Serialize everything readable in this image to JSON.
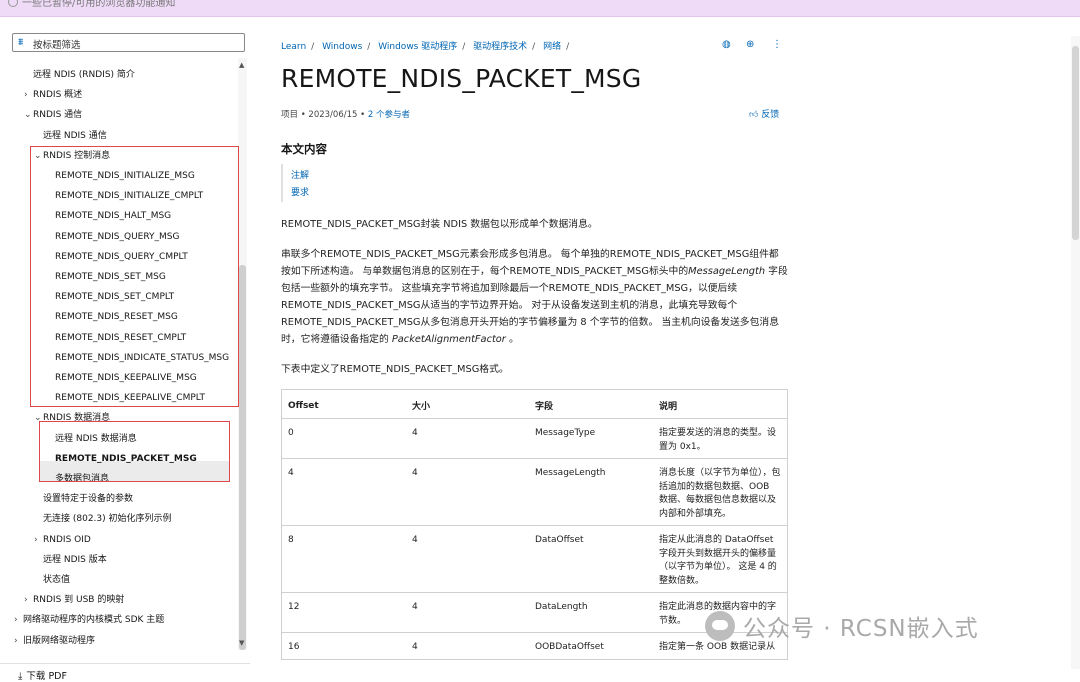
{
  "topbar": {
    "message": "一些已暂停/可用的浏览器功能通知"
  },
  "sidebar": {
    "filter_placeholder": "按标题筛选",
    "download_pdf": "下载 PDF",
    "items": [
      {
        "label": "远程 NDIS (RNDIS) 简介",
        "chev": ""
      },
      {
        "label": "RNDIS 概述",
        "chev": "›"
      },
      {
        "label": "RNDIS 通信",
        "chev": "⌄"
      },
      {
        "label": "远程 NDIS 通信",
        "chev": ""
      },
      {
        "label": "RNDIS 控制消息",
        "chev": "⌄"
      },
      {
        "label": "REMOTE_NDIS_INITIALIZE_MSG",
        "chev": ""
      },
      {
        "label": "REMOTE_NDIS_INITIALIZE_CMPLT",
        "chev": ""
      },
      {
        "label": "REMOTE_NDIS_HALT_MSG",
        "chev": ""
      },
      {
        "label": "REMOTE_NDIS_QUERY_MSG",
        "chev": ""
      },
      {
        "label": "REMOTE_NDIS_QUERY_CMPLT",
        "chev": ""
      },
      {
        "label": "REMOTE_NDIS_SET_MSG",
        "chev": ""
      },
      {
        "label": "REMOTE_NDIS_SET_CMPLT",
        "chev": ""
      },
      {
        "label": "REMOTE_NDIS_RESET_MSG",
        "chev": ""
      },
      {
        "label": "REMOTE_NDIS_RESET_CMPLT",
        "chev": ""
      },
      {
        "label": "REMOTE_NDIS_INDICATE_STATUS_MSG",
        "chev": ""
      },
      {
        "label": "REMOTE_NDIS_KEEPALIVE_MSG",
        "chev": ""
      },
      {
        "label": "REMOTE_NDIS_KEEPALIVE_CMPLT",
        "chev": ""
      },
      {
        "label": "RNDIS 数据消息",
        "chev": "⌄"
      },
      {
        "label": "远程 NDIS 数据消息",
        "chev": ""
      },
      {
        "label": "REMOTE_NDIS_PACKET_MSG",
        "chev": ""
      },
      {
        "label": "多数据包消息",
        "chev": ""
      },
      {
        "label": "设置特定于设备的参数",
        "chev": ""
      },
      {
        "label": "无连接 (802.3) 初始化序列示例",
        "chev": ""
      },
      {
        "label": "RNDIS OID",
        "chev": "›"
      },
      {
        "label": "远程 NDIS 版本",
        "chev": ""
      },
      {
        "label": "状态值",
        "chev": ""
      },
      {
        "label": "RNDIS 到 USB 的映射",
        "chev": "›"
      },
      {
        "label": "网络驱动程序的内核模式 SDK 主题",
        "chev": "›"
      },
      {
        "label": "旧版网络驱动程序",
        "chev": "›"
      }
    ]
  },
  "breadcrumb": [
    "Learn",
    "Windows",
    "Windows 驱动程序",
    "驱动程序技术",
    "网络"
  ],
  "page": {
    "title": "REMOTE_NDIS_PACKET_MSG",
    "meta_prefix": "项目 • 2023/06/15 • ",
    "contributors": "2 个参与者",
    "feedback": "反馈",
    "toc_title": "本文内容",
    "toc_links": [
      "注解",
      "要求"
    ],
    "p1": "REMOTE_NDIS_PACKET_MSG封装 NDIS 数据包以形成单个数据消息。",
    "p2a": "串联多个REMOTE_NDIS_PACKET_MSG元素会形成多包消息。 每个单独的REMOTE_NDIS_PACKET_MSG组件都按如下所述构造。 与单数据包消息的区别在于，每个REMOTE_NDIS_PACKET_MSG标头中的",
    "p2_field": "MessageLength",
    "p2b": " 字段包括一些额外的填充字节。 这些填充字节将追加到除最后一个REMOTE_NDIS_PACKET_MSG，以便后续REMOTE_NDIS_PACKET_MSG从适当的字节边界开始。 对于从设备发送到主机的消息，此填充导致每个REMOTE_NDIS_PACKET_MSG从多包消息开头开始的字节偏移量为 8 个字节的倍数。 当主机向设备发送多包消息时，它将遵循设备指定的 ",
    "p2_field2": "PacketAlignmentFactor",
    "p2c": " 。",
    "p3": "下表中定义了REMOTE_NDIS_PACKET_MSG格式。"
  },
  "table": {
    "headers": [
      "Offset",
      "大小",
      "字段",
      "说明"
    ],
    "rows": [
      [
        "0",
        "4",
        "MessageType",
        "指定要发送的消息的类型。设置为 0x1。"
      ],
      [
        "4",
        "4",
        "MessageLength",
        "消息长度（以字节为单位），包括追加的数据包数据、OOB 数据、每数据包信息数据以及内部和外部填充。"
      ],
      [
        "8",
        "4",
        "DataOffset",
        "指定从此消息的 DataOffset 字段开头到数据开头的偏移量（以字节为单位）。 这是 4 的整数倍数。"
      ],
      [
        "12",
        "4",
        "DataLength",
        "指定此消息的数据内容中的字节数。"
      ],
      [
        "16",
        "4",
        "OOBDataOffset",
        "指定第一条 OOB 数据记录从"
      ]
    ]
  },
  "watermark": "公众号 · RCSN嵌入式"
}
